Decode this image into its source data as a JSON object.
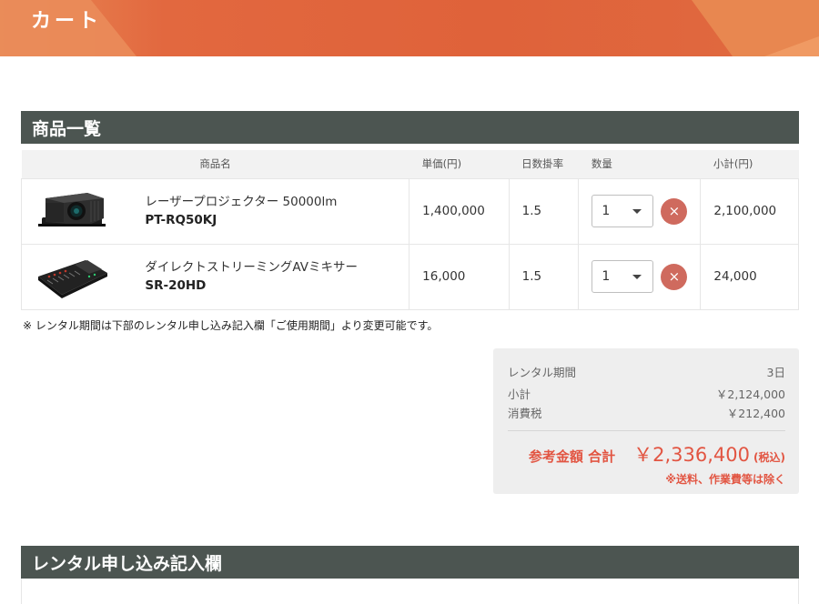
{
  "header": {
    "title": "カート"
  },
  "product_section": {
    "title": "商品一覧",
    "columns": {
      "name": "商品名",
      "unit_price": "単価(円)",
      "rate": "日数掛率",
      "quantity": "数量",
      "subtotal": "小計(円)"
    },
    "items": [
      {
        "name": "レーザープロジェクター 50000lm",
        "code": "PT-RQ50KJ",
        "unit_price": "1,400,000",
        "rate": "1.5",
        "quantity": "1",
        "subtotal": "2,100,000",
        "image_icon": "projector-image",
        "delete_icon": "×"
      },
      {
        "name": "ダイレクトストリーミングAVミキサー",
        "code": "SR-20HD",
        "unit_price": "16,000",
        "rate": "1.5",
        "quantity": "1",
        "subtotal": "24,000",
        "image_icon": "av-mixer-image",
        "delete_icon": "×"
      }
    ],
    "note": "※ レンタル期間は下部のレンタル申し込み記入欄「ご使用期間」より変更可能です。"
  },
  "summary": {
    "period_label": "レンタル期間",
    "period_value": "3日",
    "subtotal_label": "小計",
    "subtotal_value": "￥2,124,000",
    "tax_label": "消費税",
    "tax_value": "￥212,400",
    "total_label": "参考金額 合計",
    "total_value": "￥2,336,400",
    "total_suffix": "(税込)",
    "exclusion_note": "※送料、作業費等は除く"
  },
  "form_section": {
    "title": "レンタル申し込み記入欄"
  },
  "colors": {
    "accent": "#e2683f",
    "section_bar": "#4c5551",
    "delete_button": "#cf6a5e",
    "total_text": "#e25542"
  }
}
